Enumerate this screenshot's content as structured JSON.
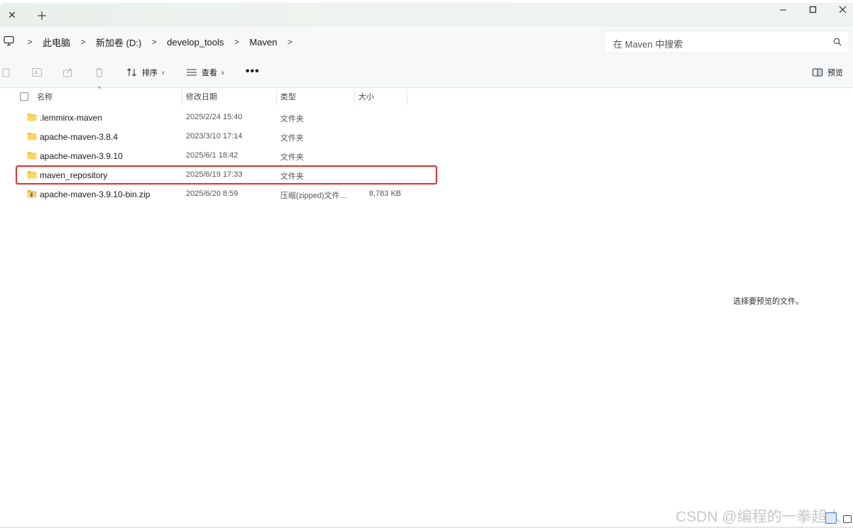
{
  "breadcrumbs": [
    "此电脑",
    "新加卷 (D:)",
    "develop_tools",
    "Maven"
  ],
  "search": {
    "placeholder": "在 Maven 中搜索"
  },
  "toolbar": {
    "sort_label": "排序",
    "view_label": "查看",
    "more_label": "•••",
    "preview_label": "预览"
  },
  "columns": {
    "name": "名称",
    "modified": "修改日期",
    "type": "类型",
    "size": "大小"
  },
  "files": [
    {
      "name": ".lemminx-maven",
      "modified": "2025/2/24 15:40",
      "type": "文件夹",
      "size": "",
      "icon": "folder-icon"
    },
    {
      "name": "apache-maven-3.8.4",
      "modified": "2023/3/10 17:14",
      "type": "文件夹",
      "size": "",
      "icon": "folder-icon"
    },
    {
      "name": "apache-maven-3.9.10",
      "modified": "2025/6/1 18:42",
      "type": "文件夹",
      "size": "",
      "icon": "folder-icon"
    },
    {
      "name": "maven_repository",
      "modified": "2025/6/19 17:33",
      "type": "文件夹",
      "size": "",
      "icon": "folder-icon",
      "highlighted": true
    },
    {
      "name": "apache-maven-3.9.10-bin.zip",
      "modified": "2025/6/20 8:59",
      "type": "压缩(zipped)文件...",
      "size": "8,783 KB",
      "icon": "zip-folder-icon"
    }
  ],
  "preview_message": "选择要预览的文件。",
  "watermark": "CSDN @编程的一拳超人",
  "colors": {
    "highlight_border": "#e03030",
    "folder_yellow": "#f5c242",
    "tab_strip": "#eaf1eb"
  }
}
